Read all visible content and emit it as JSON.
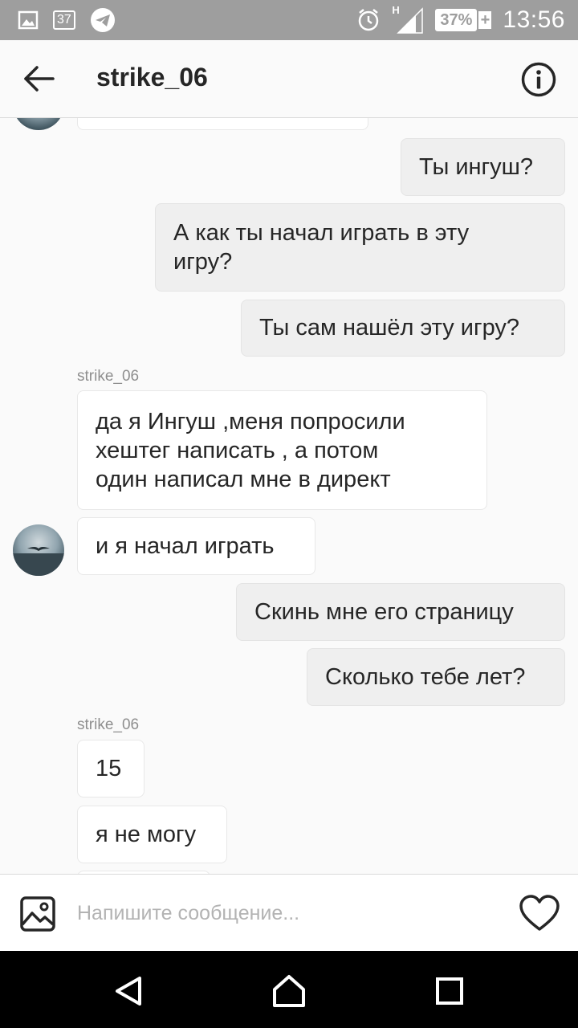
{
  "status_bar": {
    "notification_badge": "37",
    "network_label": "H",
    "battery_percent": "37%",
    "battery_charging_symbol": "+",
    "time": "13:56",
    "icons": [
      "image-notification-icon",
      "badge-icon",
      "telegram-icon",
      "alarm-icon",
      "signal-icon",
      "battery-icon"
    ]
  },
  "header": {
    "title": "strike_06",
    "back_icon": "back-arrow-icon",
    "info_icon": "info-icon"
  },
  "messages": [
    {
      "direction": "outgoing",
      "text": "Ты ингуш?"
    },
    {
      "direction": "outgoing",
      "lines": [
        "А как ты начал играть в эту",
        "игру?"
      ]
    },
    {
      "direction": "outgoing",
      "text": "Ты сам нашёл эту игру?"
    },
    {
      "direction": "incoming",
      "sender": "strike_06",
      "lines": [
        "да я Ингуш ,меня попросили",
        "хештег написать , а потом",
        "один написал мне в директ"
      ]
    },
    {
      "direction": "incoming",
      "text": "и я начал играть"
    },
    {
      "direction": "outgoing",
      "text": "Скинь мне его страницу"
    },
    {
      "direction": "outgoing",
      "text": "Сколько тебе лет?"
    },
    {
      "direction": "incoming",
      "sender": "strike_06",
      "text": "15"
    },
    {
      "direction": "incoming",
      "text": "я не могу"
    }
  ],
  "composer": {
    "placeholder": "Напишите сообщение...",
    "gallery_icon": "gallery-icon",
    "like_icon": "heart-icon"
  },
  "nav_bar": {
    "icons": [
      "nav-back-icon",
      "nav-home-icon",
      "nav-recents-icon"
    ]
  },
  "colors": {
    "status_bar": "#9e9e9e",
    "outgoing_bubble": "#efefef",
    "incoming_bubble": "#ffffff",
    "nav_bar": "#000000"
  }
}
